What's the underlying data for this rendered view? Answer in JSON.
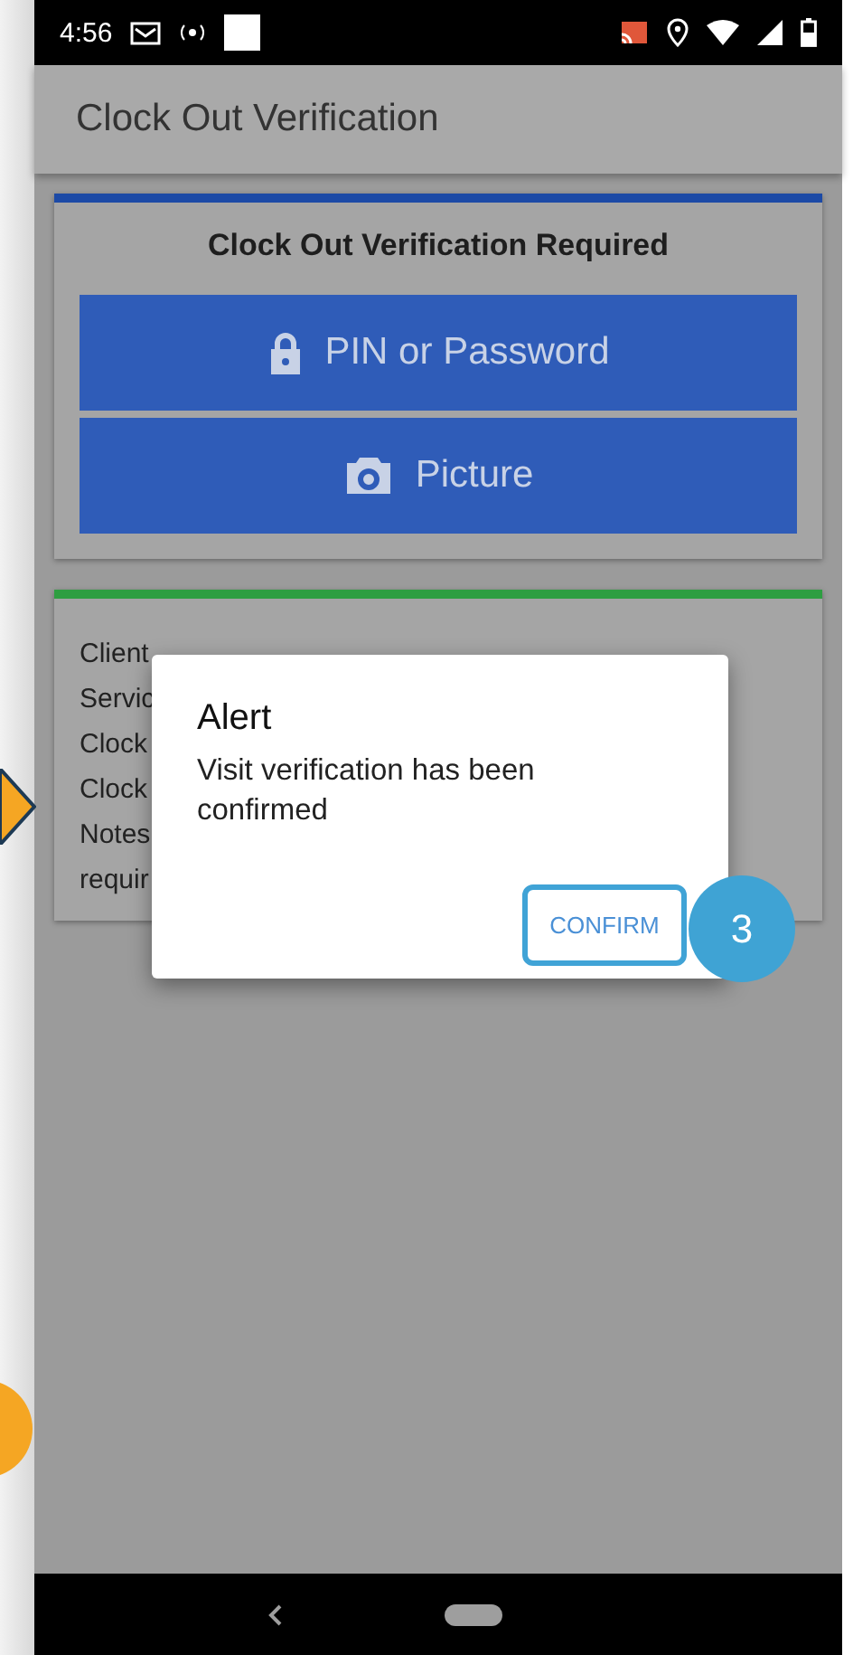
{
  "status_bar": {
    "time": "4:56"
  },
  "app_bar": {
    "title": "Clock Out Verification"
  },
  "verification_card": {
    "title": "Clock Out Verification Required",
    "buttons": [
      {
        "label": "PIN or Password",
        "kind": "lock"
      },
      {
        "label": "Picture",
        "kind": "camera"
      }
    ]
  },
  "details_card": {
    "lines": [
      "Client",
      "Servic",
      "Clock",
      "Clock",
      "Notes",
      "requir"
    ]
  },
  "dialog": {
    "title": "Alert",
    "message": "Visit verification has been confirmed",
    "button": "CONFIRM"
  },
  "callout": {
    "step": "3"
  }
}
